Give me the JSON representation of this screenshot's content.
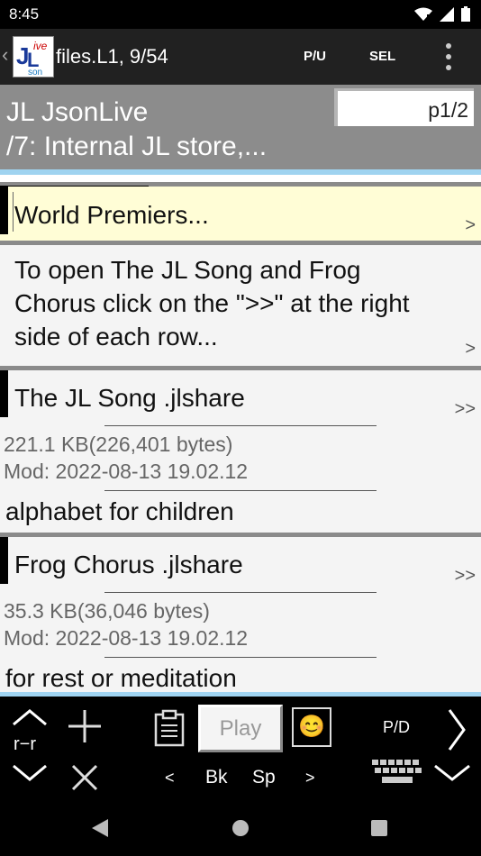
{
  "status_bar": {
    "time": "8:45"
  },
  "toolbar": {
    "title": "files.L1, 9/54",
    "pu_label": "P/U",
    "sel_label": "SEL"
  },
  "header": {
    "line1": "JL JsonLive",
    "line2": "/7: Internal JL store,...",
    "page_indicator": "p1/2"
  },
  "list": {
    "section_title": "World Premiers...",
    "section_arrow": ">",
    "instruction": [
      "To open The JL Song and Frog",
      "Chorus click on the \">>\" at the right",
      "side of each row..."
    ],
    "instruction_arrow": ">",
    "files": [
      {
        "name": "The JL Song .jlshare",
        "size": "221.1 KB(226,401 bytes)",
        "modified": "Mod: 2022-08-13 19.02.12",
        "description": "alphabet for children",
        "arrow": ">>"
      },
      {
        "name": "Frog Chorus .jlshare",
        "size": "35.3 KB(36,046 bytes)",
        "modified": "Mod: 2022-08-13 19.02.12",
        "description": "for rest or meditation",
        "arrow": ">>"
      }
    ]
  },
  "keypad": {
    "rr_label": "r−r",
    "play_label": "Play",
    "emoji": "😊",
    "pd_label": "P/D",
    "left_label": "<",
    "bk_label": "Bk",
    "sp_label": "Sp",
    "right_label": ">"
  }
}
